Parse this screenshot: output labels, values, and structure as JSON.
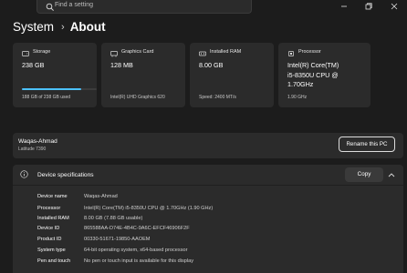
{
  "search": {
    "placeholder": "Find a setting"
  },
  "breadcrumb": {
    "parent": "System",
    "current": "About"
  },
  "cards": [
    {
      "title": "Storage",
      "value": "238 GB",
      "sub": "188 GB of 238 GB used",
      "used_fraction": 0.79
    },
    {
      "title": "Graphics Card",
      "value": "128 MB",
      "sub": "Intel(R) UHD Graphics 620"
    },
    {
      "title": "Installed RAM",
      "value": "8.00 GB",
      "sub": "Speed: 2400 MT/s"
    },
    {
      "title": "Processor",
      "value_lines": [
        "Intel(R) Core(TM)",
        "i5-8350U CPU @",
        "1.70GHz"
      ],
      "sub": "1.90 GHz"
    }
  ],
  "device": {
    "name": "Waqas-Ahmad",
    "model": "Latitude 7390",
    "rename_label": "Rename this PC"
  },
  "specs": {
    "title": "Device specifications",
    "copy_label": "Copy",
    "rows": [
      {
        "key": "Device name",
        "value": "Waqas-Ahmad"
      },
      {
        "key": "Processor",
        "value": "Intel(R) Core(TM) i5-8350U CPU @ 1.70GHz (1.90 GHz)"
      },
      {
        "key": "Installed RAM",
        "value": "8.00 GB (7.88 GB usable)"
      },
      {
        "key": "Device ID",
        "value": "865588AA-D74E-4B4C-9A6C-EFCF46906F2F"
      },
      {
        "key": "Product ID",
        "value": "00330-51671-19850-AAOEM"
      },
      {
        "key": "System type",
        "value": "64-bit operating system, x64-based processor"
      },
      {
        "key": "Pen and touch",
        "value": "No pen or touch input is available for this display"
      }
    ]
  },
  "colors": {
    "background": "#1c1c1c",
    "card": "#2b2b2b",
    "accent": "#4cc2ff"
  }
}
